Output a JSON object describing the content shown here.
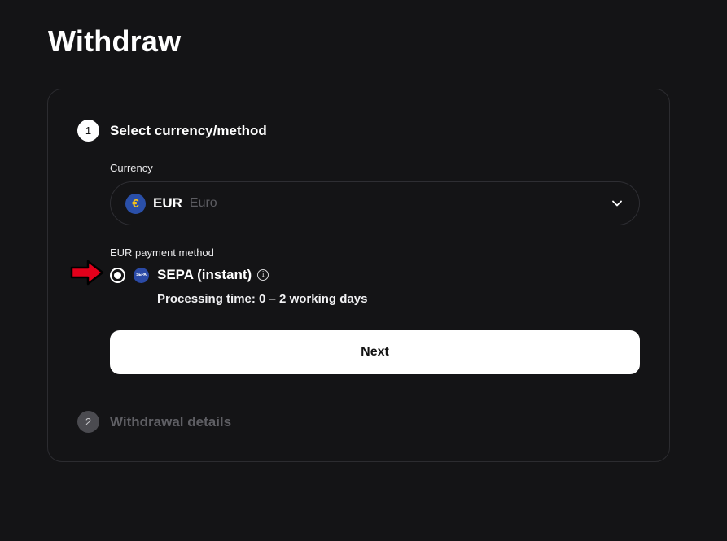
{
  "page": {
    "title": "Withdraw"
  },
  "steps": [
    {
      "number": "1",
      "title": "Select currency/method"
    },
    {
      "number": "2",
      "title": "Withdrawal details"
    }
  ],
  "currency": {
    "label": "Currency",
    "icon": "euro-icon",
    "icon_glyph": "€",
    "code": "EUR",
    "name": "Euro"
  },
  "payment_method": {
    "label": "EUR payment method",
    "selected": true,
    "icon": "sepa-icon",
    "icon_text": "SEPA",
    "name": "SEPA (instant)",
    "processing": "Processing time: 0 – 2 working days"
  },
  "next_button": {
    "label": "Next"
  },
  "colors": {
    "background": "#141416",
    "card_border": "#2c2c30",
    "accent_arrow": "#e3001b",
    "button_bg": "#ffffff"
  }
}
